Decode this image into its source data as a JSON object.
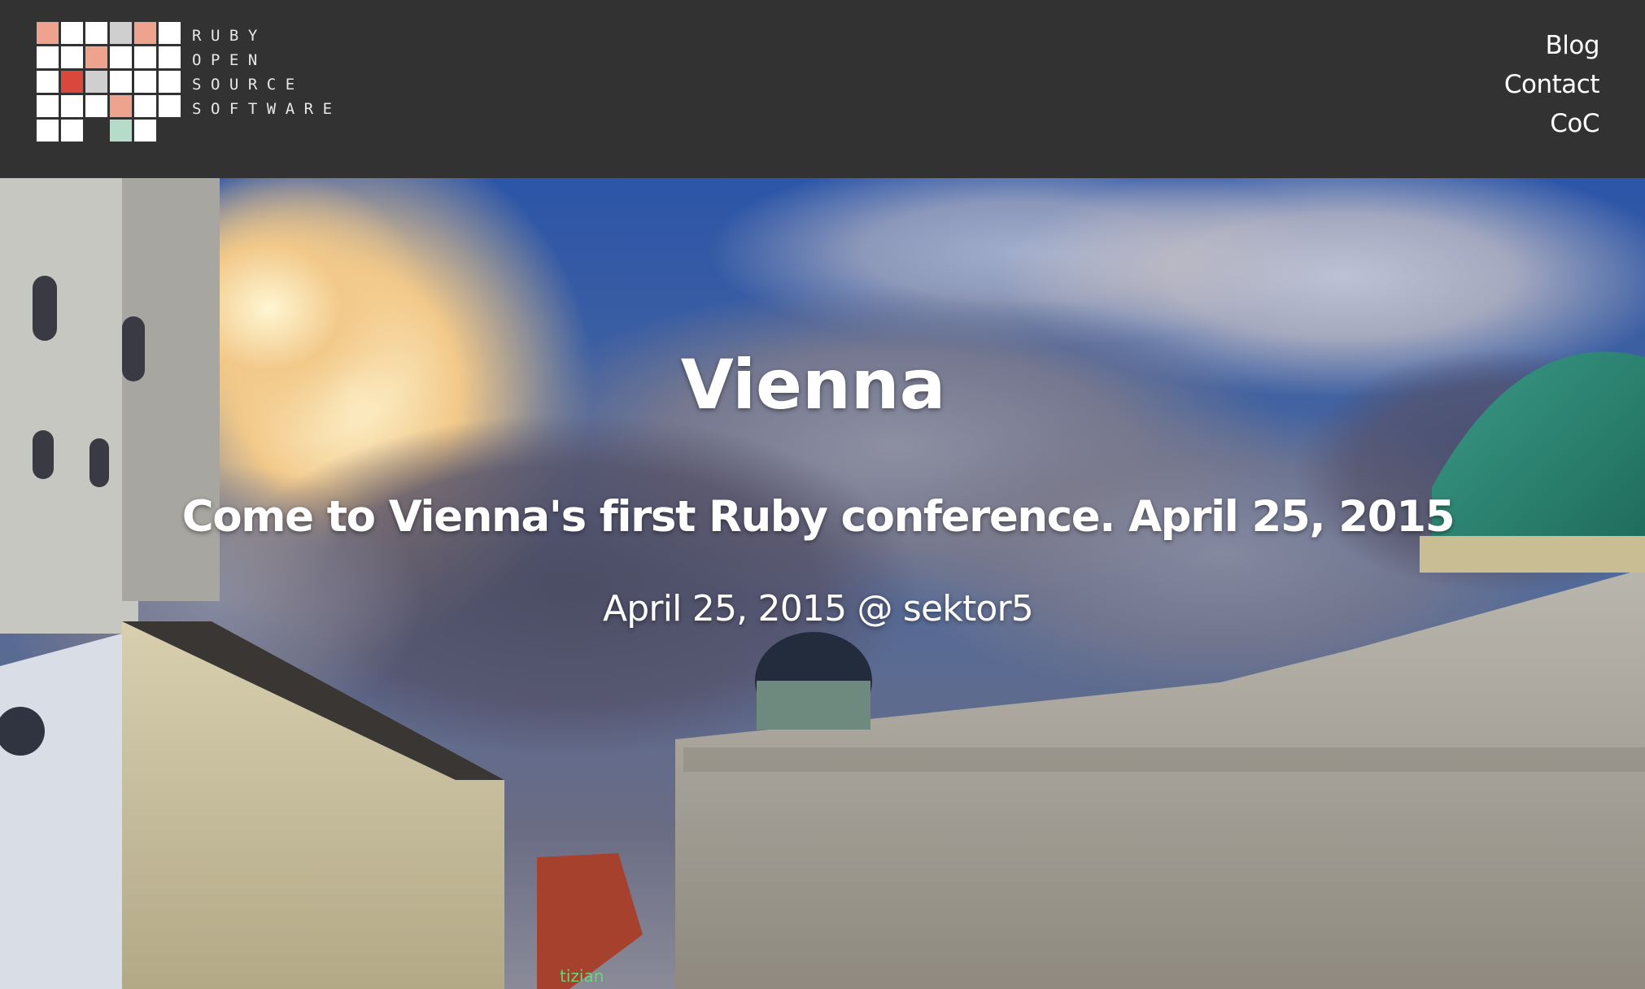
{
  "header": {
    "logo": {
      "lines": [
        "RUBY",
        "OPEN",
        "SOURCE",
        "SOFTWARE"
      ],
      "grid_colors": [
        [
          "#eea38e",
          "#ffffff",
          "#ffffff",
          "#cfcfcf",
          "#eea38e",
          "#ffffff"
        ],
        [
          "#ffffff",
          "#ffffff",
          "#eea38e",
          "#ffffff",
          "#ffffff",
          "#ffffff"
        ],
        [
          "#ffffff",
          "#d9473d",
          "#cfcfcf",
          "#ffffff",
          "#ffffff",
          "#ffffff"
        ],
        [
          "#ffffff",
          "#ffffff",
          "#ffffff",
          "#eea38e",
          "#ffffff",
          "#ffffff"
        ],
        [
          "#ffffff",
          "#ffffff",
          null,
          "#b4dcc8",
          "#ffffff",
          null
        ]
      ]
    },
    "nav": [
      {
        "label": "Blog"
      },
      {
        "label": "Contact"
      },
      {
        "label": "CoC"
      }
    ]
  },
  "hero": {
    "title": "Vienna",
    "subtitle": "Come to Vienna's first Ruby conference. April 25, 2015",
    "meta": "April 25, 2015 @ sektor5",
    "storefront_sign": "tizian"
  },
  "colors": {
    "header_bg": "#323232",
    "text": "#ffffff"
  }
}
